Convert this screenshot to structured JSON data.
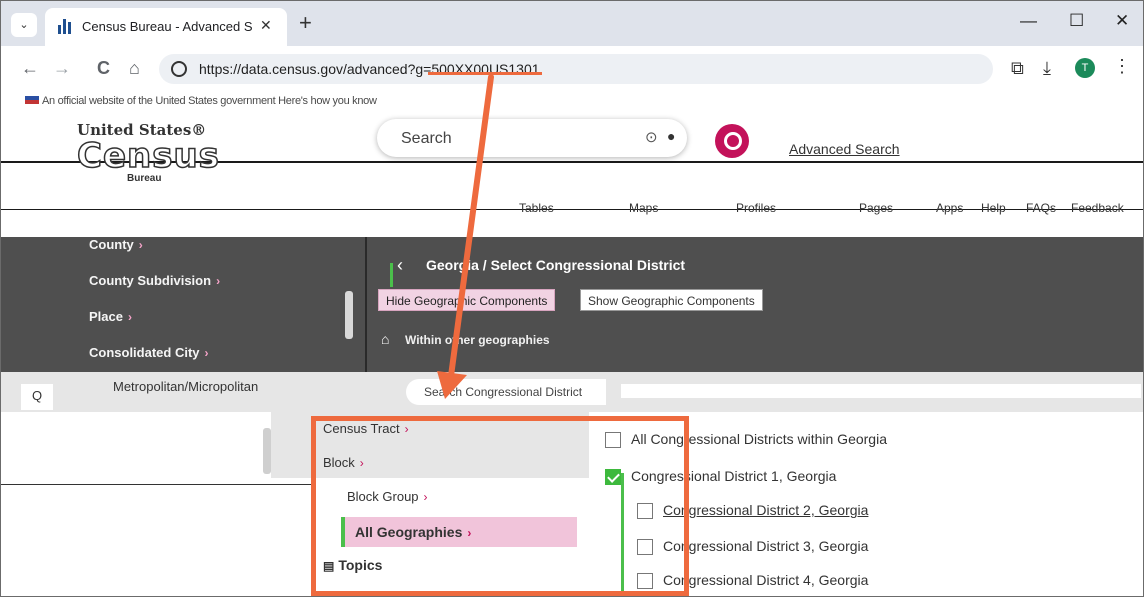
{
  "browser": {
    "tab_title": "Census Bureau - Advanced Sear",
    "tab_close": "✕",
    "new_tab": "+",
    "tab_list": "⌄",
    "url": "https://data.census.gov/advanced?g=500XX00US1301",
    "avatar_letter": "T",
    "window_minimize": "—",
    "window_maximize": "☐",
    "window_close": "✕",
    "back": "←",
    "forward": "→",
    "reload": "C",
    "home": "⌂",
    "extensions": "⧉",
    "download": "⤓",
    "menu": "⋮"
  },
  "page": {
    "gov_banner": "An official website of the United States government  Here's how you know",
    "logo": {
      "line1": "United States®",
      "line2": "Census",
      "line3": "Bureau"
    },
    "search_placeholder": "Search",
    "advanced_search": "Advanced Search",
    "nav": [
      "Tables",
      "Maps",
      "Profiles",
      "Pages",
      "Apps",
      "Help",
      "FAQs",
      "Feedback"
    ],
    "left_geo_list": [
      {
        "label": "County",
        "chev": "›"
      },
      {
        "label": "County Subdivision",
        "chev": "›"
      },
      {
        "label": "Place",
        "chev": "›"
      },
      {
        "label": "Consolidated City",
        "chev": "›"
      }
    ],
    "breadcrumb_back": "‹",
    "breadcrumb_title": "Georgia / Select Congressional District",
    "hide_geo": "Hide Geographic Components",
    "show_geo": "Show Geographic Components",
    "within_other": "Within other geographies",
    "metro_label": "Metropolitan/Micropolitan",
    "district_search_placeholder": "Search Congressional District",
    "left_items": [
      {
        "label": "Census Tract",
        "chev": "›"
      },
      {
        "label": "Block",
        "chev": "›"
      },
      {
        "label": "Block Group",
        "chev": "›"
      }
    ],
    "all_geographies": "All Geographies",
    "all_geographies_chev": "›",
    "topics": "Topics",
    "checklist": [
      {
        "label": "All Congressional Districts within Georgia",
        "checked": false
      },
      {
        "label": "Congressional District 1, Georgia",
        "checked": true
      },
      {
        "label": "Congressional District 2, Georgia",
        "checked": false
      },
      {
        "label": "Congressional District 3, Georgia",
        "checked": false
      },
      {
        "label": "Congressional District 4, Georgia",
        "checked": false
      }
    ]
  },
  "colors": {
    "annotation": "#ee6a3e",
    "accent_magenta": "#c3125a",
    "check_green": "#3db93d",
    "dark_panel": "#4f4f4f"
  }
}
